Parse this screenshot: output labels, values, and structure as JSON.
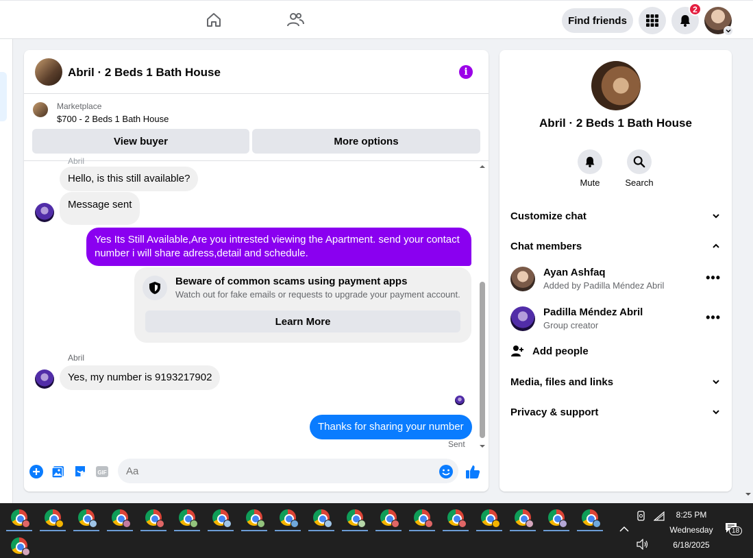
{
  "topbar": {
    "find_friends": "Find friends",
    "notifications_count": "2",
    "icons": [
      "home-icon",
      "friends-icon",
      "menu-grid-icon",
      "bell-icon",
      "account-avatar"
    ]
  },
  "chat": {
    "title": "Abril · 2 Beds 1 Bath House",
    "marketplace_label": "Marketplace",
    "marketplace_listing": "$700 - 2 Beds 1 Bath House",
    "view_buyer": "View buyer",
    "more_options": "More options",
    "messages": [
      {
        "sender": "Abril",
        "text": "Hello, is this still available?"
      },
      {
        "text": "Message sent"
      },
      {
        "text": "Yes Its Still Available,Are you intrested viewing the Apartment. send your contact number i will share adress,detail and schedule."
      },
      {
        "sender": "Abril",
        "text": "Yes, my number is 9193217902"
      },
      {
        "text": "Thanks for sharing your number"
      }
    ],
    "scam_warning": {
      "title": "Beware of common scams using payment apps",
      "body": "Watch out for fake emails or requests to upgrade your payment account.",
      "button": "Learn More"
    },
    "sent_status": "Sent",
    "composer_placeholder": "Aa"
  },
  "info_panel": {
    "title": "Abril · 2 Beds 1 Bath House",
    "mute": "Mute",
    "search": "Search",
    "customize_chat": "Customize chat",
    "chat_members": "Chat members",
    "members": [
      {
        "name": "Ayan Ashfaq",
        "sub": "Added by Padilla Méndez Abril"
      },
      {
        "name": "Padilla Méndez Abril",
        "sub": "Group creator"
      }
    ],
    "add_people": "Add people",
    "media": "Media, files and links",
    "privacy": "Privacy & support"
  },
  "taskbar": {
    "time": "8:25 PM",
    "day": "Wednesday",
    "date": "6/18/2025",
    "notif_count": "18"
  },
  "colors": {
    "accent_purple": "#8a00f0",
    "blue_bubble": "#0a7cff",
    "badge_red": "#e41e3f"
  }
}
